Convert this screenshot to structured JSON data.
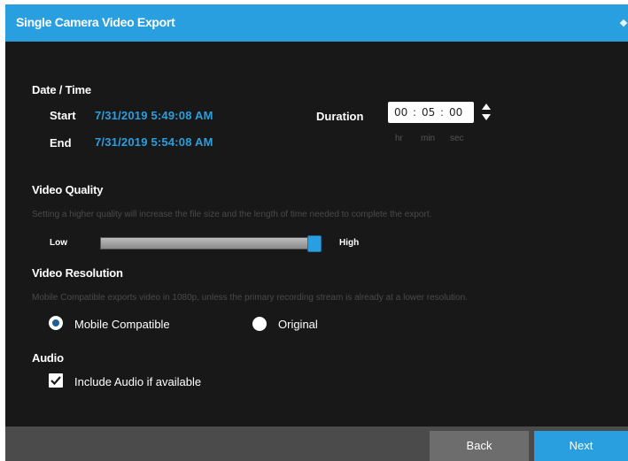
{
  "window": {
    "title": "Single Camera Video Export"
  },
  "datetime": {
    "section_title": "Date / Time",
    "start_label": "Start",
    "start_value": "7/31/2019 5:49:08 AM",
    "end_label": "End",
    "end_value": "7/31/2019 5:54:08 AM",
    "duration_label": "Duration",
    "duration": {
      "hr": "00",
      "min": "05",
      "sec": "00",
      "separator": ":",
      "unit_hr": "hr",
      "unit_min": "min",
      "unit_sec": "sec"
    }
  },
  "video_quality": {
    "section_title": "Video Quality",
    "hint": "Setting a higher quality will increase the file size and the length of time needed to complete the export.",
    "low_label": "Low",
    "high_label": "High",
    "level_fraction": 1.0
  },
  "video_resolution": {
    "section_title": "Video Resolution",
    "hint": "Mobile Compatible exports video in 1080p, unless the primary recording stream is already at a lower resolution.",
    "options": [
      {
        "label": "Mobile Compatible",
        "selected": true
      },
      {
        "label": "Original",
        "selected": false
      }
    ]
  },
  "audio": {
    "section_title": "Audio",
    "include_label": "Include Audio if available",
    "checked": true
  },
  "footer": {
    "back_label": "Back",
    "next_label": "Next"
  },
  "colors": {
    "accent": "#2a9fe0",
    "body_bg": "#181818",
    "footer_bg": "#4b4b4b"
  }
}
